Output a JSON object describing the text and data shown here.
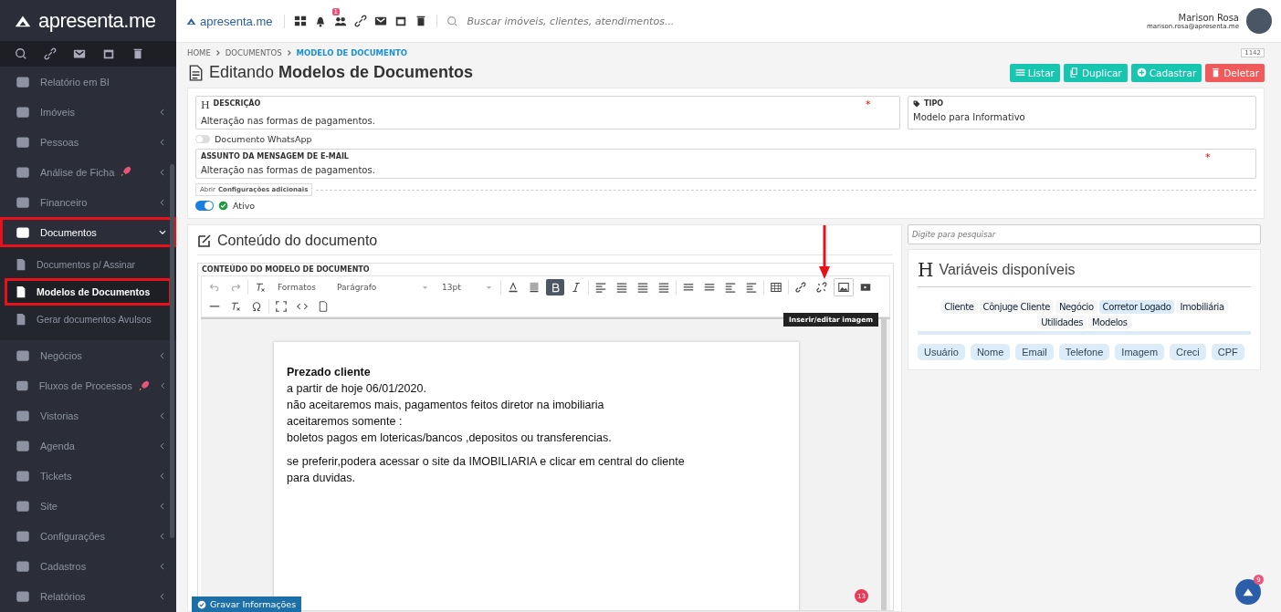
{
  "sidebar": {
    "logo": "apresenta.me",
    "items": [
      {
        "label": "Relatório em BI",
        "rocket": false,
        "has_children": false,
        "expanded": false,
        "highlighted": false
      },
      {
        "label": "Imóveis",
        "rocket": false,
        "has_children": true,
        "expanded": false,
        "highlighted": false
      },
      {
        "label": "Pessoas",
        "rocket": false,
        "has_children": true,
        "expanded": false,
        "highlighted": false
      },
      {
        "label": "Análise de Ficha",
        "rocket": true,
        "has_children": true,
        "expanded": false,
        "highlighted": false
      },
      {
        "label": "Financeiro",
        "rocket": false,
        "has_children": true,
        "expanded": false,
        "highlighted": false
      },
      {
        "label": "Documentos",
        "rocket": false,
        "has_children": true,
        "expanded": true,
        "highlighted": true,
        "children": [
          {
            "label": "Documentos p/ Assinar",
            "selected": false,
            "highlighted": false
          },
          {
            "label": "Modelos de Documentos",
            "selected": true,
            "highlighted": true
          },
          {
            "label": "Gerar documentos Avulsos",
            "selected": false,
            "highlighted": false
          }
        ]
      },
      {
        "label": "Negócios",
        "rocket": false,
        "has_children": true,
        "expanded": false,
        "highlighted": false
      },
      {
        "label": "Fluxos de Processos",
        "rocket": true,
        "has_children": true,
        "expanded": false,
        "highlighted": false
      },
      {
        "label": "Vistorias",
        "rocket": false,
        "has_children": true,
        "expanded": false,
        "highlighted": false
      },
      {
        "label": "Agenda",
        "rocket": false,
        "has_children": true,
        "expanded": false,
        "highlighted": false
      },
      {
        "label": "Tickets",
        "rocket": false,
        "has_children": true,
        "expanded": false,
        "highlighted": false
      },
      {
        "label": "Site",
        "rocket": false,
        "has_children": true,
        "expanded": false,
        "highlighted": false
      },
      {
        "label": "Configurações",
        "rocket": false,
        "has_children": true,
        "expanded": false,
        "highlighted": false
      },
      {
        "label": "Cadastros",
        "rocket": false,
        "has_children": true,
        "expanded": false,
        "highlighted": false
      },
      {
        "label": "Relatórios",
        "rocket": false,
        "has_children": true,
        "expanded": false,
        "highlighted": false
      }
    ]
  },
  "header": {
    "logo": "apresenta.me",
    "notification_count": "1",
    "search": {
      "placeholder": "Buscar imóveis, clientes, atendimentos..."
    },
    "user": {
      "name": "Marison Rosa",
      "email": "marison.rosa@apresenta.me"
    }
  },
  "breadcrumb": [
    {
      "label": "HOME",
      "selected": false
    },
    {
      "label": "DOCUMENTOS",
      "selected": false
    },
    {
      "label": "MODELO DE DOCUMENTO",
      "selected": true
    }
  ],
  "record_id": "1142",
  "page_title": "Editando **Modelos de Documentos**",
  "actions": [
    {
      "label": "Listar",
      "kind": "list"
    },
    {
      "label": "Duplicar",
      "kind": "copy"
    },
    {
      "label": "Cadastrar",
      "kind": "add"
    },
    {
      "label": "Deletar",
      "kind": "delete"
    }
  ],
  "form": {
    "description": {
      "icon": "H",
      "label": "DESCRIÇÃO",
      "value": "Alteração nas formas de pagamentos.",
      "required_mark": "*"
    },
    "type": {
      "label": "TIPO",
      "value": "Modelo para Informativo"
    },
    "whatsapp": {
      "label": "Documento WhatsApp",
      "on": false
    },
    "email_subject": {
      "label": "ASSUNTO DA MENSAGEM DE E-MAIL",
      "value": "Alteração nas formas de pagamentos.",
      "required_mark": "*"
    },
    "more_settings": "Abrir **Configurações adicionais**",
    "active": {
      "label": "Ativo",
      "on": true
    }
  },
  "content": {
    "title": "Conteúdo do documento",
    "editor_label": "CONTEÚDO DO MODELO DE DOCUMENTO",
    "toolbar": {
      "dropdowns": [
        "Formatos",
        "Parágrafo",
        "13pt"
      ],
      "bold_active": true,
      "tooltip": "Inserir/editar imagem"
    },
    "paragraphs": [
      [
        "**Prezado cliente**",
        "a partir de hoje 06/01/2020.",
        "não aceitaremos mais, pagamentos feitos diretor na imobiliaria",
        "aceitaremos somente :",
        "boletos pagos em lotericas/bancos ,depositos ou transferencias."
      ],
      [
        "se preferir,podera acessar o site da IMOBILIARIA e clicar em central do cliente",
        "para duvidas."
      ]
    ],
    "error_count": "13"
  },
  "variables": {
    "search": {
      "placeholder": "Digite para pesquisar"
    },
    "title_icon": "H",
    "title": "Variáveis disponíveis",
    "categories": [
      {
        "label": "Cliente",
        "selected": false
      },
      {
        "label": "Cônjuge Cliente",
        "selected": false
      },
      {
        "label": "Negócio",
        "selected": false
      },
      {
        "label": "Corretor Logado",
        "selected": true
      },
      {
        "label": "Imobiliária",
        "selected": false
      },
      {
        "label": "Utilidades",
        "selected": false
      },
      {
        "label": "Modelos",
        "selected": false
      }
    ],
    "items": [
      "Usuário",
      "Nome",
      "Email",
      "Telefone",
      "Imagem",
      "Creci",
      "CPF"
    ]
  },
  "save_button": "Gravar Informações",
  "chat_badge": "9"
}
